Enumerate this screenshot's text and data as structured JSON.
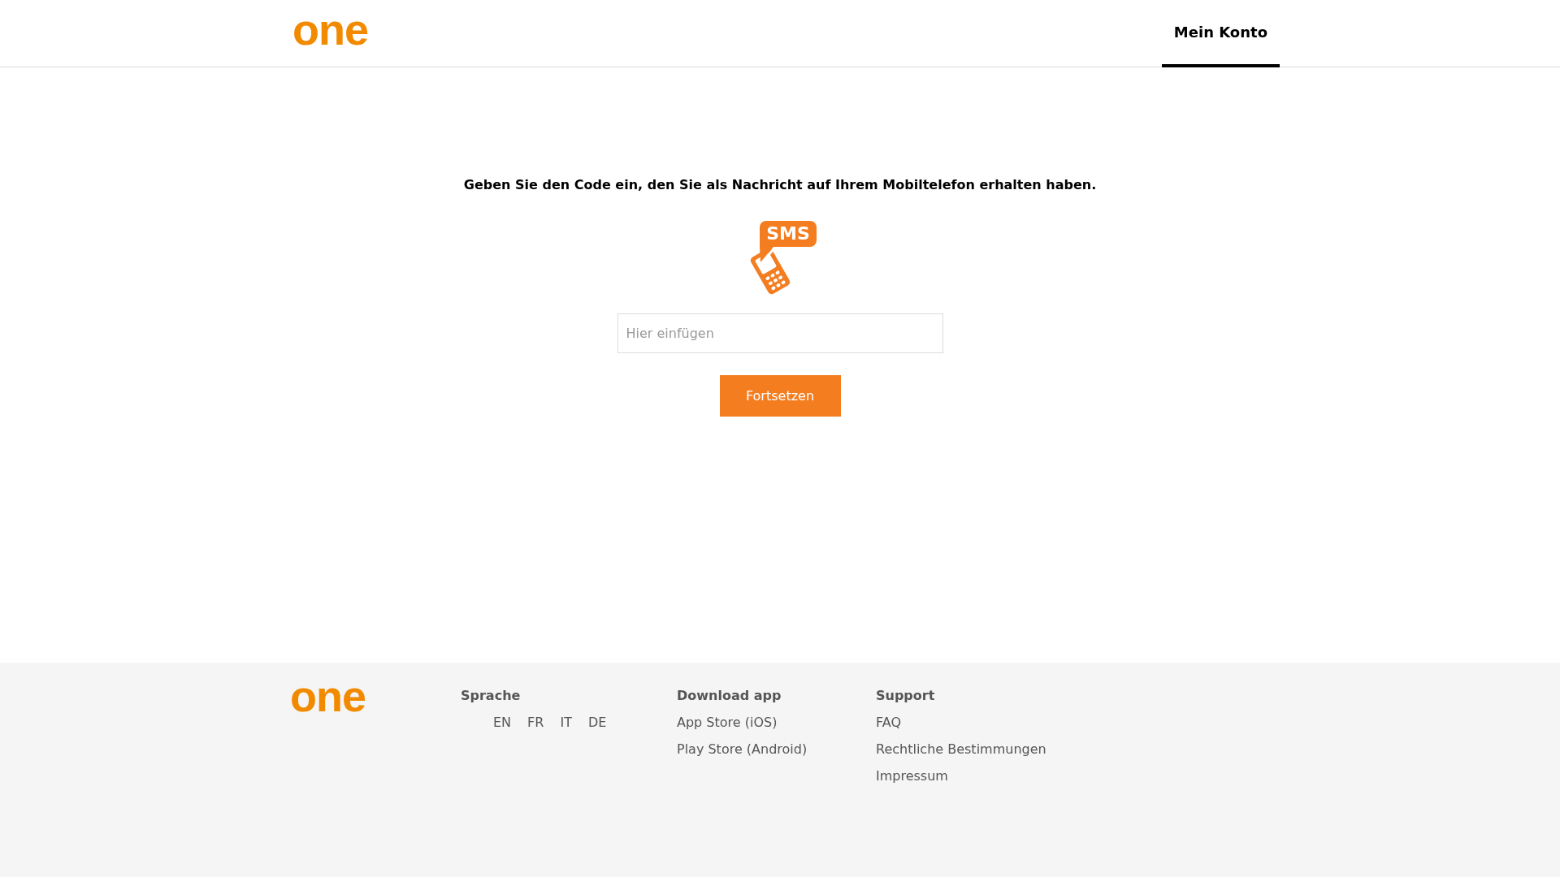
{
  "header": {
    "logo": "one",
    "tabs": [
      {
        "label": "Mein Konto",
        "selected": true
      }
    ]
  },
  "verification": {
    "instruction": "Geben Sie den Code ein, den Sie als Nachricht auf Ihrem Mobiltelefon erhalten haben.",
    "sms_icon": {
      "label": "SMS"
    },
    "code_field": {
      "placeholder": "Hier einfügen"
    },
    "submit_button": "Fortsetzen"
  },
  "footer": {
    "logo": "one",
    "columns": [
      {
        "heading": "Sprache",
        "kind": "inline",
        "links": [
          "EN",
          "FR",
          "IT",
          "DE"
        ]
      },
      {
        "heading": "Download app",
        "kind": "stacked",
        "links": [
          "App Store (iOS)",
          "Play Store (Android)"
        ]
      },
      {
        "heading": "Support",
        "kind": "stacked",
        "links": [
          "FAQ",
          "Rechtliche Bestimmungen",
          "Impressum"
        ]
      }
    ]
  }
}
